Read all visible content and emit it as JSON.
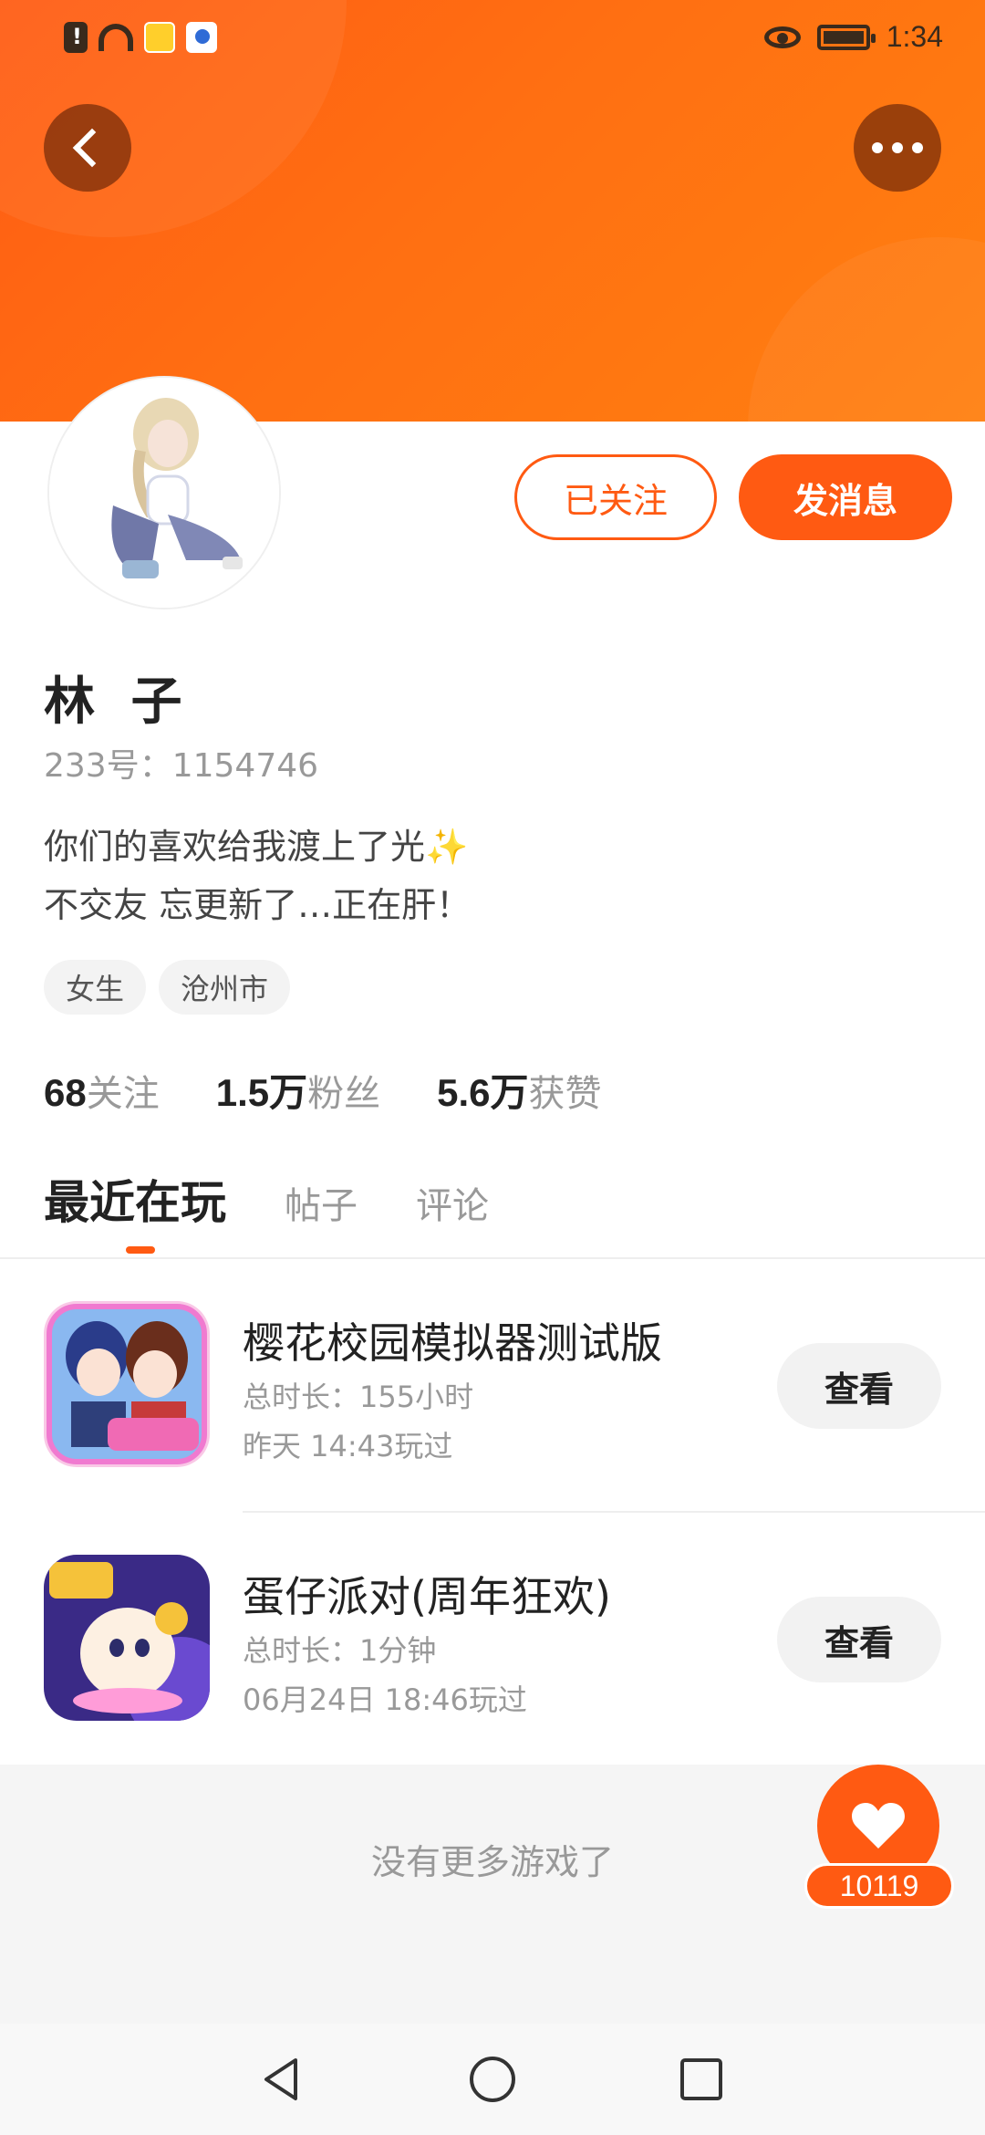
{
  "status_bar": {
    "time": "1:34"
  },
  "profile": {
    "follow_button": "已关注",
    "message_button": "发消息",
    "name": "林 子",
    "id_label": "233号：1154746",
    "bio_line1": "你们的喜欢给我渡上了光",
    "bio_sparkle": "✨",
    "bio_line2": "不交友 忘更新了…正在肝！",
    "tags": [
      "女生",
      "沧州市"
    ]
  },
  "stats": [
    {
      "num": "68",
      "label": "关注"
    },
    {
      "num": "1.5万",
      "label": "粉丝"
    },
    {
      "num": "5.6万",
      "label": "获赞"
    }
  ],
  "tabs": [
    "最近在玩",
    "帖子",
    "评论"
  ],
  "games": [
    {
      "title": "樱花校园模拟器测试版",
      "duration": "总时长：155小时",
      "last_played": "昨天 14:43玩过",
      "button": "查看"
    },
    {
      "title": "蛋仔派对(周年狂欢)",
      "duration": "总时长：1分钟",
      "last_played": "06月24日 18:46玩过",
      "button": "查看"
    }
  ],
  "footer": {
    "no_more": "没有更多游戏了"
  },
  "like": {
    "count": "10119"
  },
  "colors": {
    "accent": "#ff5a12",
    "header_start": "#ff5c14",
    "header_end": "#ff8010"
  },
  "icons": [
    "back-icon",
    "more-icon",
    "heart-icon",
    "nav-back-icon",
    "nav-home-icon",
    "nav-recent-icon"
  ]
}
